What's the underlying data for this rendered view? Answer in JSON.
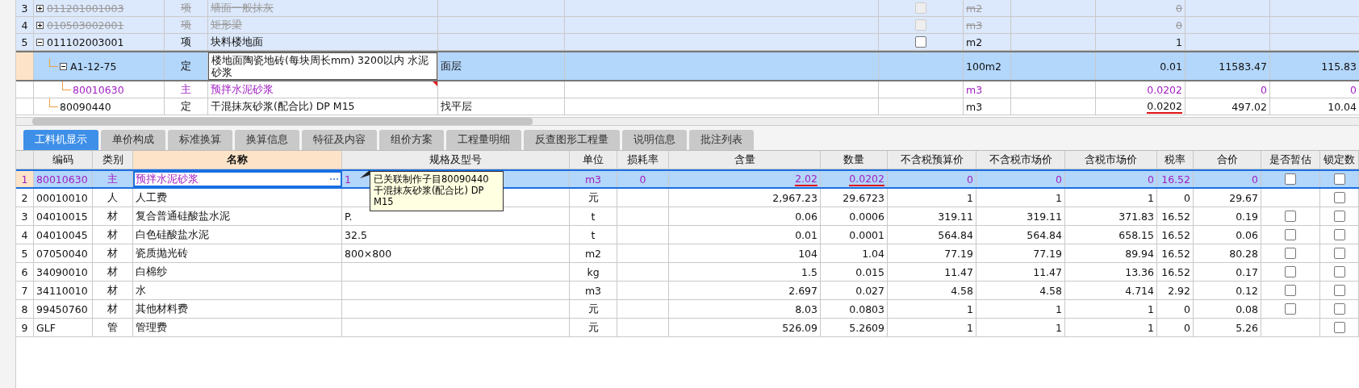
{
  "top_grid": {
    "rows": [
      {
        "number": "3",
        "code": "011201001003",
        "expanded": false,
        "type": "项",
        "name": "墙面一般抹灰",
        "kind": "bill",
        "disabled": true,
        "checked": false,
        "unit": "m2",
        "quantity": "0",
        "selected": false
      },
      {
        "number": "4",
        "code": "010503002001",
        "expanded": false,
        "type": "项",
        "name": "矩形梁",
        "kind": "bill",
        "disabled": true,
        "checked": false,
        "unit": "m3",
        "quantity": "0",
        "selected": false
      },
      {
        "number": "5",
        "code": "011102003001",
        "expanded": true,
        "type": "项",
        "name": "块料楼地面",
        "kind": "bill",
        "disabled": false,
        "checked": false,
        "unit": "m2",
        "quantity": "1",
        "selected": false,
        "children": [
          {
            "code": "A1-12-75",
            "expanded": true,
            "type": "定",
            "name": "楼地面陶瓷地砖(每块周长mm) 3200以内 水泥砂浆",
            "column_5": "面层",
            "kind": "quota",
            "unit": "100m2",
            "quantity": "0.01",
            "price": "11583.47",
            "total": "115.83",
            "selected": true,
            "children": [
              {
                "code": "80010630",
                "type": "主",
                "name": "预拌水泥砂浆",
                "kind": "main_material",
                "unit": "m3",
                "quantity": "0.0202",
                "price": "0",
                "total": "0",
                "selected": false,
                "comment": true
              }
            ]
          },
          {
            "code": "80090440",
            "type": "定",
            "name": "干混抹灰砂浆(配合比) DP M15",
            "column_5": "找平层",
            "kind": "quota",
            "unit": "m3",
            "quantity": "0.0202",
            "price": "497.02",
            "total": "10.04",
            "selected": false,
            "quantity_underlined": true
          }
        ]
      }
    ]
  },
  "tabs": [
    {
      "label": "工料机显示",
      "selected": true
    },
    {
      "label": "单价构成",
      "selected": false
    },
    {
      "label": "标准换算",
      "selected": false
    },
    {
      "label": "换算信息",
      "selected": false
    },
    {
      "label": "特征及内容",
      "selected": false
    },
    {
      "label": "组价方案",
      "selected": false
    },
    {
      "label": "工程量明细",
      "selected": false
    },
    {
      "label": "反查图形工程量",
      "selected": false
    },
    {
      "label": "说明信息",
      "selected": false
    },
    {
      "label": "批注列表",
      "selected": false
    }
  ],
  "resource_table": {
    "columns": [
      {
        "label": "编码",
        "selected": false
      },
      {
        "label": "类别",
        "selected": false
      },
      {
        "label": "名称",
        "selected": true
      },
      {
        "label": "规格及型号",
        "selected": false
      },
      {
        "label": "单位",
        "selected": false
      },
      {
        "label": "损耗率",
        "selected": false
      },
      {
        "label": "含量",
        "selected": false
      },
      {
        "label": "数量",
        "selected": false
      },
      {
        "label": "不含税预算价",
        "selected": false
      },
      {
        "label": "不含税市场价",
        "selected": false
      },
      {
        "label": "含税市场价",
        "selected": false
      },
      {
        "label": "税率",
        "selected": false
      },
      {
        "label": "合价",
        "selected": false
      },
      {
        "label": "是否暂估",
        "selected": false
      },
      {
        "label": "锁定数",
        "selected": false
      }
    ],
    "rows": [
      {
        "number": "1",
        "kind": "main_material",
        "selected": true,
        "code": "80010630",
        "type": "主",
        "name": "预拌水泥砂浆",
        "spec": "1",
        "unit": "m3",
        "loss_rate": "0",
        "content": "2.02",
        "quantity": "0.0202",
        "budget_price": "0",
        "market_price": "0",
        "market_price_tax": "0",
        "tax_rate": "16.52",
        "total": "0",
        "estimated": false,
        "locked": false,
        "content_underlined": true,
        "quantity_underlined": true
      },
      {
        "number": "2",
        "kind": "resource",
        "selected": false,
        "code": "00010010",
        "type": "人",
        "name": "人工费",
        "unit": "元",
        "content": "2,967.23",
        "quantity": "29.6723",
        "budget_price": "1",
        "market_price": "1",
        "market_price_tax": "1",
        "tax_rate": "0",
        "total": "29.67",
        "locked": false
      },
      {
        "number": "3",
        "kind": "resource",
        "selected": false,
        "code": "04010015",
        "type": "材",
        "name": "复合普通硅酸盐水泥",
        "spec": "P.",
        "unit": "t",
        "content": "0.06",
        "quantity": "0.0006",
        "budget_price": "319.11",
        "market_price": "319.11",
        "market_price_tax": "371.83",
        "tax_rate": "16.52",
        "total": "0.19",
        "estimated": false,
        "locked": false
      },
      {
        "number": "4",
        "kind": "resource",
        "selected": false,
        "code": "04010045",
        "type": "材",
        "name": "白色硅酸盐水泥",
        "spec": "32.5",
        "unit": "t",
        "content": "0.01",
        "quantity": "0.0001",
        "budget_price": "564.84",
        "market_price": "564.84",
        "market_price_tax": "658.15",
        "tax_rate": "16.52",
        "total": "0.06",
        "estimated": false,
        "locked": false
      },
      {
        "number": "5",
        "kind": "resource",
        "selected": false,
        "code": "07050040",
        "type": "材",
        "name": "瓷质抛光砖",
        "spec": "800×800",
        "unit": "m2",
        "content": "104",
        "quantity": "1.04",
        "budget_price": "77.19",
        "market_price": "77.19",
        "market_price_tax": "89.94",
        "tax_rate": "16.52",
        "total": "80.28",
        "estimated": false,
        "locked": false
      },
      {
        "number": "6",
        "kind": "resource",
        "selected": false,
        "code": "34090010",
        "type": "材",
        "name": "白棉纱",
        "unit": "kg",
        "content": "1.5",
        "quantity": "0.015",
        "budget_price": "11.47",
        "market_price": "11.47",
        "market_price_tax": "13.36",
        "tax_rate": "16.52",
        "total": "0.17",
        "estimated": false,
        "locked": false
      },
      {
        "number": "7",
        "kind": "resource",
        "selected": false,
        "code": "34110010",
        "type": "材",
        "name": "水",
        "unit": "m3",
        "content": "2.697",
        "quantity": "0.027",
        "budget_price": "4.58",
        "market_price": "4.58",
        "market_price_tax": "4.714",
        "tax_rate": "2.92",
        "total": "0.12",
        "estimated": false,
        "locked": false
      },
      {
        "number": "8",
        "kind": "resource",
        "selected": false,
        "code": "99450760",
        "type": "材",
        "name": "其他材料费",
        "unit": "元",
        "content": "8.03",
        "quantity": "0.0803",
        "budget_price": "1",
        "market_price": "1",
        "market_price_tax": "1",
        "tax_rate": "0",
        "total": "0.08",
        "estimated": false,
        "locked": false
      },
      {
        "number": "9",
        "kind": "resource",
        "selected": false,
        "code": "GLF",
        "type": "管",
        "name": "管理费",
        "unit": "元",
        "content": "526.09",
        "quantity": "5.2609",
        "budget_price": "1",
        "market_price": "1",
        "market_price_tax": "1",
        "tax_rate": "0",
        "total": "5.26",
        "locked": false
      }
    ]
  },
  "tooltip": {
    "text": "已关联制作子目80090440 干混抹灰砂浆(配合比) DP M15"
  }
}
